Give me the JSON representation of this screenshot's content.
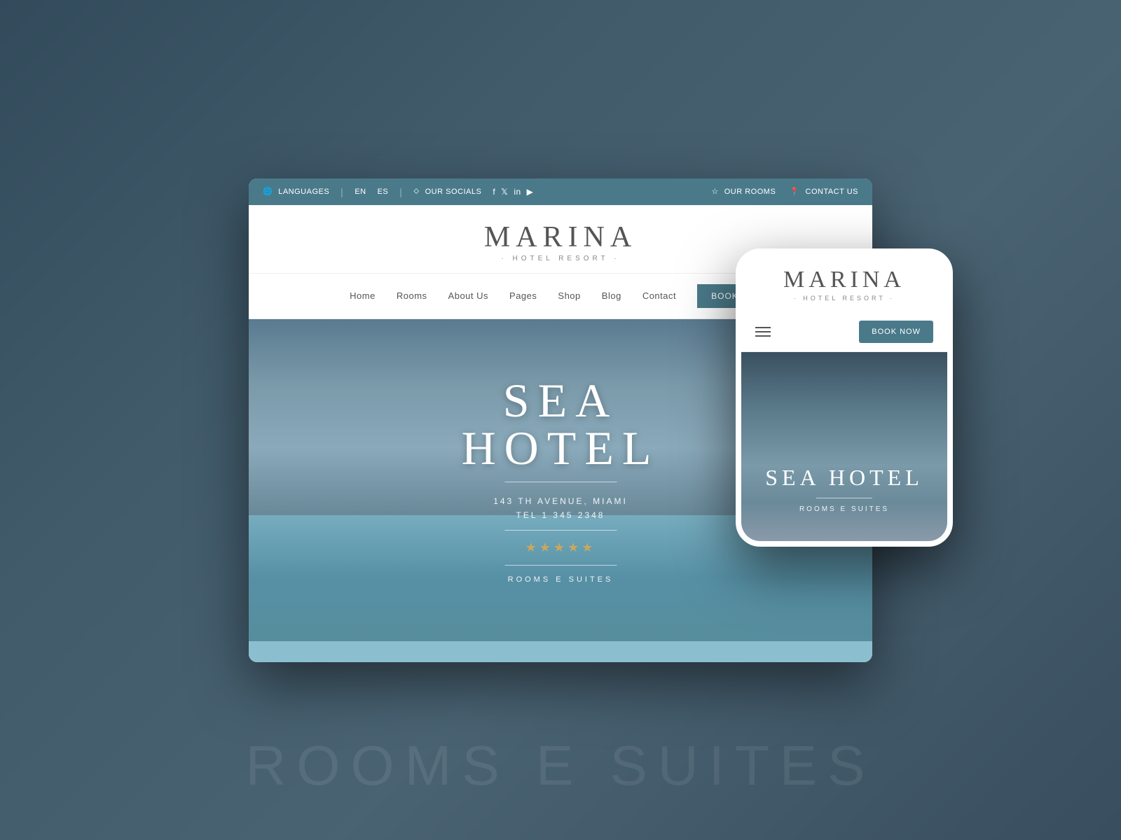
{
  "background": {
    "color": "#4a6b7c"
  },
  "topbar": {
    "languages_label": "LANGUAGES",
    "lang_en": "EN",
    "lang_es": "ES",
    "socials_label": "OUR SOCIALS",
    "rooms_label": "OUR ROOMS",
    "contact_label": "CONTACT US"
  },
  "desktop": {
    "logo_main": "MARINA",
    "logo_sub": "· HOTEL RESORT ·",
    "nav": {
      "items": [
        "Home",
        "Rooms",
        "About Us",
        "Pages",
        "Shop",
        "Blog",
        "Contact"
      ],
      "book_btn": "BOOK N..."
    },
    "hero": {
      "title": "SEA HOTEL",
      "address": "143 TH AVENUE, MIAMI",
      "tel": "TEL 1 345 2348",
      "stars": "★★★★★",
      "rooms_link": "ROOMS E SUITES"
    }
  },
  "mobile": {
    "logo_main": "MARINA",
    "logo_sub": "· HOTEL RESORT ·",
    "book_btn": "BOOK NOW",
    "hero": {
      "title": "SEA HOTEL",
      "rooms_link": "ROOMS E SUITES"
    }
  },
  "bg_text": "ROOMS E SUITES"
}
